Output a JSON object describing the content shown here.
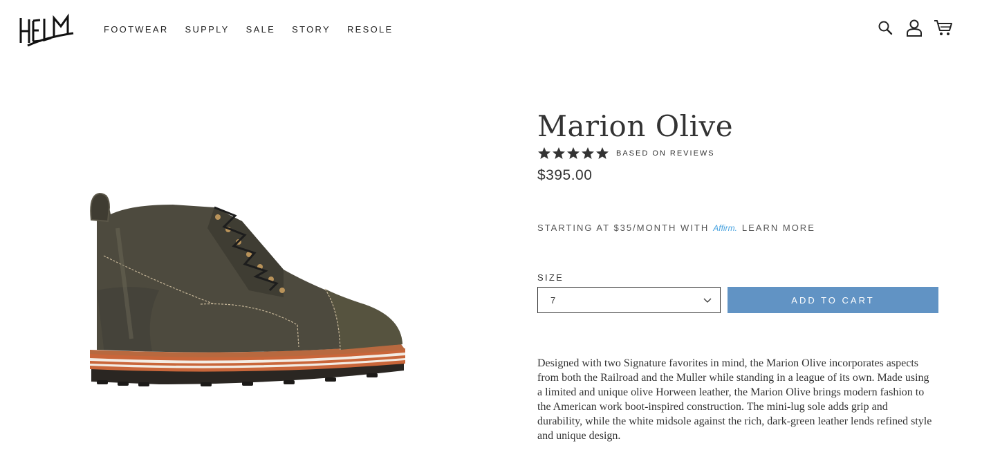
{
  "header": {
    "logo_text": "HELM",
    "nav": [
      {
        "label": "FOOTWEAR"
      },
      {
        "label": "SUPPLY"
      },
      {
        "label": "SALE"
      },
      {
        "label": "STORY"
      },
      {
        "label": "RESOLE"
      }
    ],
    "icons": [
      "search-icon",
      "account-icon",
      "cart-icon"
    ]
  },
  "product": {
    "title": "Marion Olive",
    "rating_stars": 5,
    "reviews_text": "BASED ON REVIEWS",
    "price": "$395.00",
    "affirm": {
      "prefix": "STARTING AT $35/MONTH WITH",
      "brand": "Affirm.",
      "link": "LEARN MORE"
    },
    "size": {
      "label": "SIZE",
      "selected": "7"
    },
    "add_to_cart_label": "ADD TO CART",
    "description": "Designed with two Signature favorites in mind, the Marion Olive incorporates aspects from both the Railroad and the Muller while standing in a league of its own. Made using a limited and unique olive Horween leather, the Marion Olive brings modern fashion to the American work boot-inspired construction. The mini-lug sole adds grip and durability, while the white midsole against the rich, dark-green leather lends refined style and unique design."
  },
  "colors": {
    "accent": "#6193c4",
    "affirm": "#4aa3df",
    "text": "#333333"
  }
}
